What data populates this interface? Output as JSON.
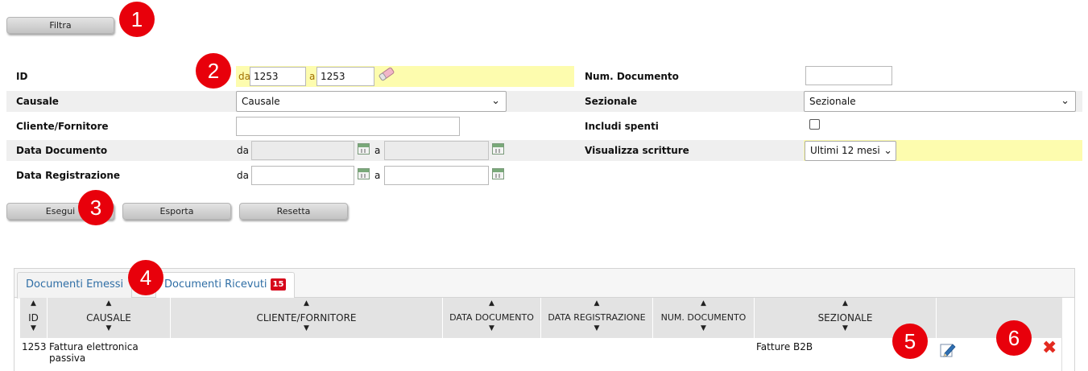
{
  "toolbar": {
    "filter_label": "Filtra"
  },
  "badges": [
    "1",
    "2",
    "3",
    "4",
    "5",
    "6"
  ],
  "form": {
    "id": {
      "label": "ID",
      "from_label": "da",
      "from_value": "1253",
      "to_label": "a",
      "to_value": "1253"
    },
    "num_documento": {
      "label": "Num. Documento",
      "value": ""
    },
    "causale": {
      "label": "Causale",
      "selected": "Causale"
    },
    "sezionale": {
      "label": "Sezionale",
      "selected": "Sezionale"
    },
    "cliente_fornitore": {
      "label": "Cliente/Fornitore",
      "value": ""
    },
    "includi_spenti": {
      "label": "Includi spenti",
      "checked": false
    },
    "data_documento": {
      "label": "Data Documento",
      "from_label": "da",
      "to_label": "a"
    },
    "visualizza_scritture": {
      "label": "Visualizza scritture",
      "selected": "Ultimi 12 mesi"
    },
    "data_registrazione": {
      "label": "Data Registrazione",
      "from_label": "da",
      "to_label": "a"
    }
  },
  "actions": {
    "esegui": "Esegui",
    "esporta": "Esporta",
    "resetta": "Resetta"
  },
  "tabs": [
    {
      "label": "Documenti Emessi",
      "active": false
    },
    {
      "label": "Documenti Ricevuti",
      "active": true,
      "count": "15"
    }
  ],
  "table": {
    "columns": [
      "ID",
      "CAUSALE",
      "CLIENTE/FORNITORE",
      "DATA DOCUMENTO",
      "DATA REGISTRAZIONE",
      "NUM. DOCUMENTO",
      "SEZIONALE"
    ],
    "rows": [
      {
        "id": "1253",
        "causale": "Fattura elettronica passiva",
        "cliente_fornitore": "",
        "data_documento": "",
        "data_registrazione": "",
        "num_documento": "",
        "sezionale": "Fatture B2B"
      }
    ]
  },
  "icons": {
    "eraser": "eraser-icon",
    "calendar": "calendar-icon",
    "edit": "edit-icon",
    "delete": "delete-icon",
    "sort_up": "sort-up-icon",
    "sort_down": "sort-down-icon"
  },
  "colors": {
    "highlight": "#fdfcae",
    "badge": "#e8000b",
    "tab_link": "#2f6ea5",
    "delete": "#e32a1f"
  }
}
